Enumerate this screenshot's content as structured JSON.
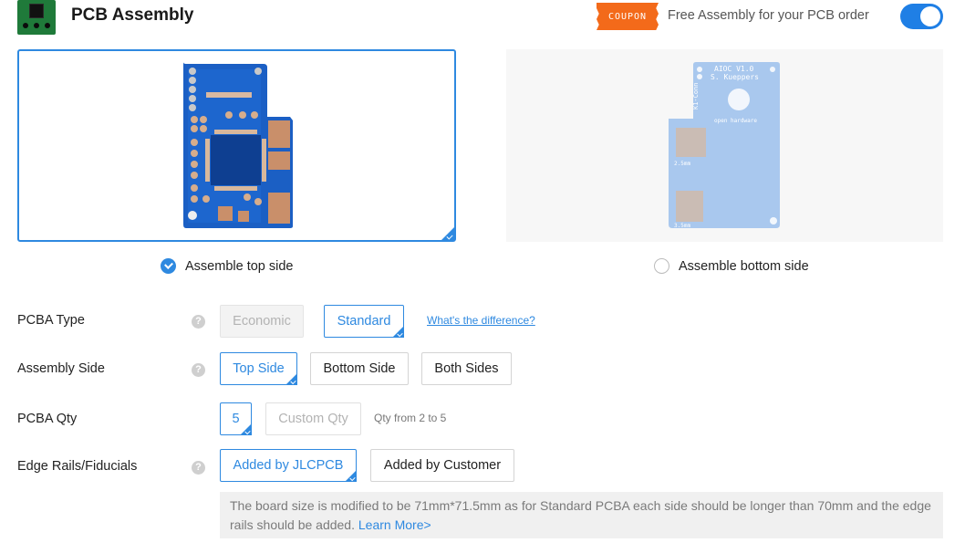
{
  "header": {
    "title": "PCB Assembly",
    "coupon_label": "COUPON",
    "coupon_text": "Free Assembly for your PCB order",
    "toggle_on": true
  },
  "board_preview": {
    "bottom_labels": [
      "AIOC V1.0",
      "S. Kueppers",
      "open hardware",
      "K1-Conn",
      "2.5mm",
      "3.5mm"
    ]
  },
  "sides": {
    "top_label": "Assemble top side",
    "bottom_label": "Assemble bottom side",
    "selected": "top"
  },
  "options": {
    "pcba_type": {
      "label": "PCBA Type",
      "choices": [
        "Economic",
        "Standard"
      ],
      "selected": "Standard",
      "disabled": "Economic",
      "link": "What's the difference?"
    },
    "assembly_side": {
      "label": "Assembly Side",
      "choices": [
        "Top Side",
        "Bottom Side",
        "Both Sides"
      ],
      "selected": "Top Side"
    },
    "pcba_qty": {
      "label": "PCBA Qty",
      "value": "5",
      "custom_placeholder": "Custom Qty",
      "hint": "Qty from 2 to 5"
    },
    "edge_rails": {
      "label": "Edge Rails/Fiducials",
      "choices": [
        "Added by JLCPCB",
        "Added by Customer"
      ],
      "selected": "Added by JLCPCB"
    }
  },
  "info": {
    "text": "The board size is modified to be 71mm*71.5mm as for Standard PCBA each side should be longer than 70mm and the edge rails should be added.",
    "link": "Learn More>"
  },
  "colors": {
    "accent": "#2e89e0",
    "coupon": "#f36a1a",
    "logo": "#1f7a3a"
  }
}
